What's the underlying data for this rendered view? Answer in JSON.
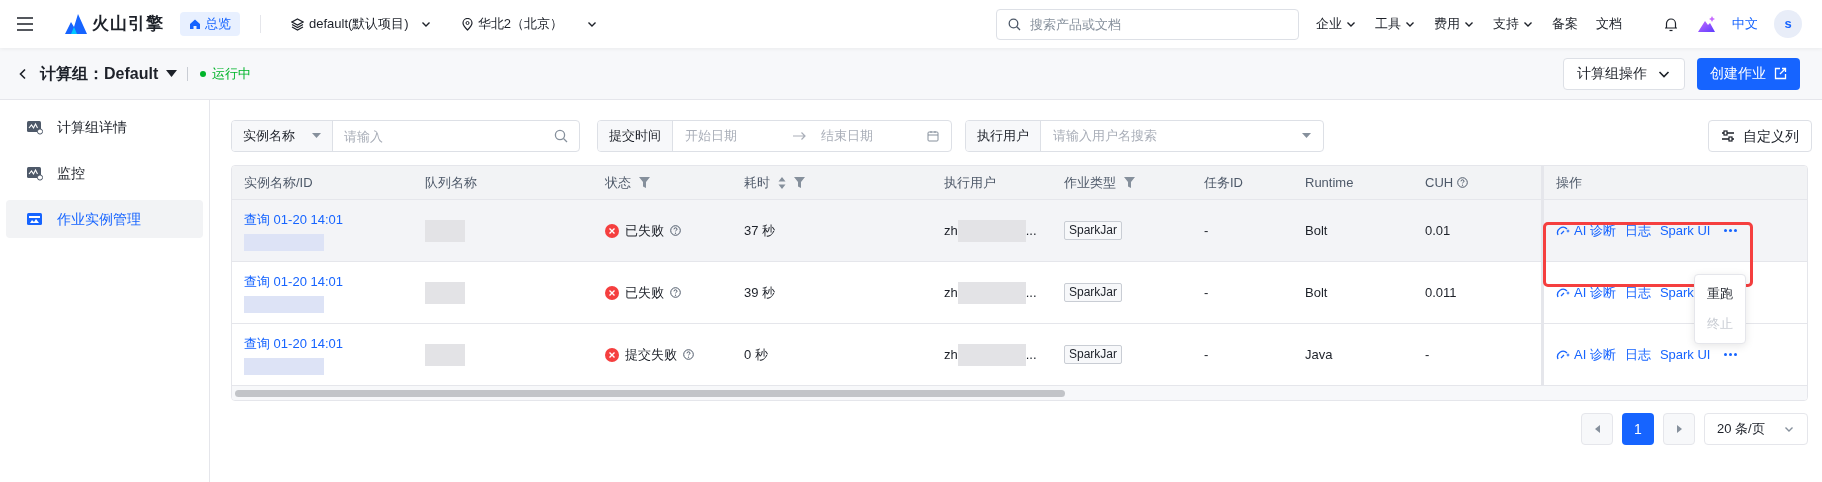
{
  "topbar": {
    "brand": "火山引擎",
    "overview": "总览",
    "project": "default(默认项目)",
    "region": "华北2（北京）",
    "search_placeholder": "搜索产品或文档",
    "menus": [
      {
        "label": "企业",
        "dropdown": true
      },
      {
        "label": "工具",
        "dropdown": true
      },
      {
        "label": "费用",
        "dropdown": true
      },
      {
        "label": "支持",
        "dropdown": true
      },
      {
        "label": "备案",
        "dropdown": false
      },
      {
        "label": "文档",
        "dropdown": false
      }
    ],
    "language": "中文",
    "avatar": "s"
  },
  "header": {
    "title": "计算组：Default",
    "status": "运行中",
    "buttons": [
      {
        "label": "计算组操作",
        "kind": "dropdown"
      },
      {
        "label": "创建作业",
        "kind": "primary"
      }
    ]
  },
  "sidebar": {
    "items": [
      {
        "label": "计算组详情",
        "selected": false
      },
      {
        "label": "监控",
        "selected": false
      },
      {
        "label": "作业实例管理",
        "selected": true
      }
    ]
  },
  "filters": [
    {
      "kind": "select-input",
      "label": "实例名称",
      "placeholder": "请输入"
    },
    {
      "kind": "date-range",
      "label": "提交时间",
      "start_placeholder": "开始日期",
      "end_placeholder": "结束日期"
    },
    {
      "kind": "select",
      "label": "执行用户",
      "placeholder": "请输入用户名搜索"
    }
  ],
  "customize_button": "自定义列",
  "table": {
    "columns": [
      {
        "label": "实例名称/ID",
        "sort": false,
        "filter": false,
        "help": false
      },
      {
        "label": "队列名称",
        "sort": false,
        "filter": false,
        "help": false
      },
      {
        "label": "状态",
        "sort": false,
        "filter": true,
        "help": false
      },
      {
        "label": "耗时",
        "sort": true,
        "filter": true,
        "help": false
      },
      {
        "label": "执行用户",
        "sort": false,
        "filter": false,
        "help": false
      },
      {
        "label": "作业类型",
        "sort": false,
        "filter": true,
        "help": false
      },
      {
        "label": "任务ID",
        "sort": false,
        "filter": false,
        "help": false
      },
      {
        "label": "Runtime",
        "sort": false,
        "filter": false,
        "help": false
      },
      {
        "label": "CUH",
        "sort": false,
        "filter": false,
        "help": true
      },
      {
        "label": "操作",
        "sort": false,
        "filter": false,
        "help": false
      }
    ],
    "rows": [
      {
        "hovered": true,
        "name": "查询 01-20 14:01",
        "status": "已失败",
        "duration": "37 秒",
        "user_prefix": "zh",
        "user_suffix": "...",
        "job_type": "SparkJar",
        "task_id": "-",
        "runtime": "Bolt",
        "cuh": "0.01",
        "actions": [
          "AI 诊断",
          "日志",
          "Spark UI"
        ],
        "more": true
      },
      {
        "hovered": false,
        "name": "查询 01-20 14:01",
        "status": "已失败",
        "duration": "39 秒",
        "user_prefix": "zh",
        "user_suffix": "...",
        "job_type": "SparkJar",
        "task_id": "-",
        "runtime": "Bolt",
        "cuh": "0.011",
        "actions": [
          "AI 诊断",
          "日志",
          "Spark"
        ]
      },
      {
        "hovered": false,
        "name": "查询 01-20 14:01",
        "status": "提交失败",
        "duration": "0 秒",
        "user_prefix": "zh",
        "user_suffix": "...",
        "job_type": "SparkJar",
        "task_id": "-",
        "runtime": "Java",
        "cuh": "-",
        "actions": [
          "AI 诊断",
          "日志",
          "Spark UI"
        ],
        "more": true
      }
    ]
  },
  "more_menu": {
    "items": [
      {
        "label": "重跑",
        "disabled": false
      },
      {
        "label": "终止",
        "disabled": true
      }
    ]
  },
  "pagination": {
    "pages": [
      {
        "label": "1",
        "selected": true
      }
    ],
    "page_size": "20 条/页"
  }
}
